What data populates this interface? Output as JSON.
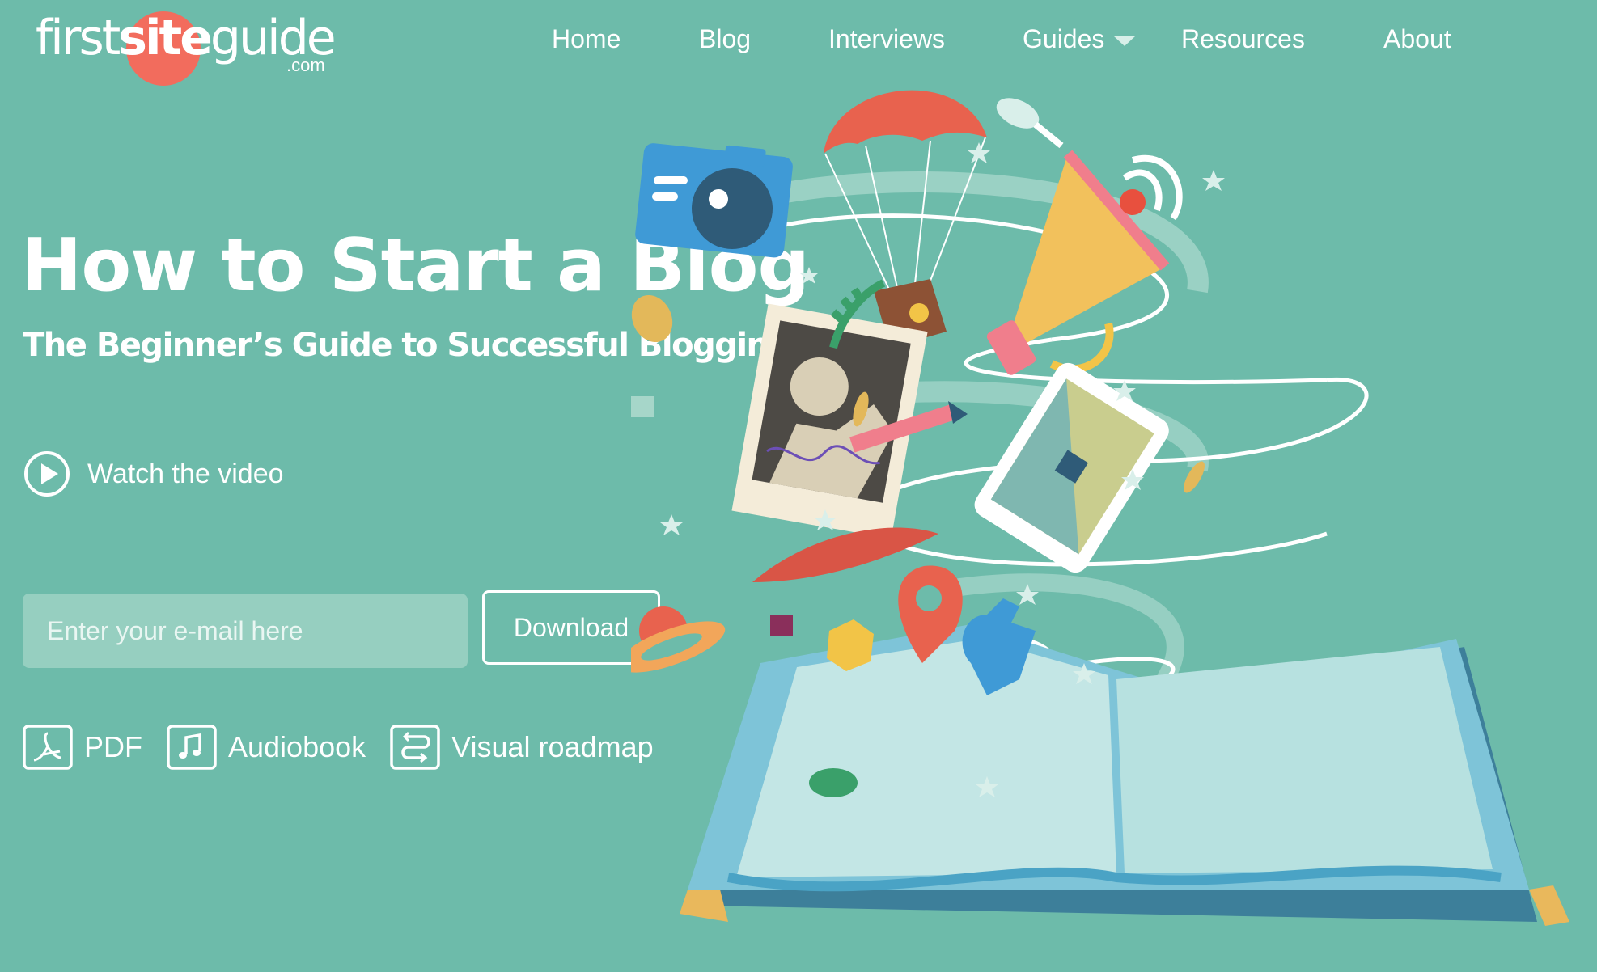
{
  "logo": {
    "first": "first",
    "site": "site",
    "guide": "guide",
    "domain": ".com"
  },
  "nav": {
    "items": [
      {
        "label": "Home"
      },
      {
        "label": "Blog"
      },
      {
        "label": "Interviews"
      },
      {
        "label": "Guides",
        "has_dropdown": true
      },
      {
        "label": "Resources"
      },
      {
        "label": "About"
      }
    ]
  },
  "hero": {
    "title": "How to Start a Blog",
    "subtitle": "The Beginner’s Guide to Successful Blogging",
    "video_label": "Watch the video",
    "email_placeholder": "Enter your e-mail here",
    "download_label": "Download",
    "formats": [
      {
        "label": "PDF",
        "icon": "pdf-icon"
      },
      {
        "label": "Audiobook",
        "icon": "music-note-icon"
      },
      {
        "label": "Visual roadmap",
        "icon": "roadmap-icon"
      }
    ]
  },
  "colors": {
    "background": "#6dbbaa",
    "logo_circle": "#f26c5d",
    "input_bg": "#96cfc0",
    "text": "#ffffff"
  }
}
